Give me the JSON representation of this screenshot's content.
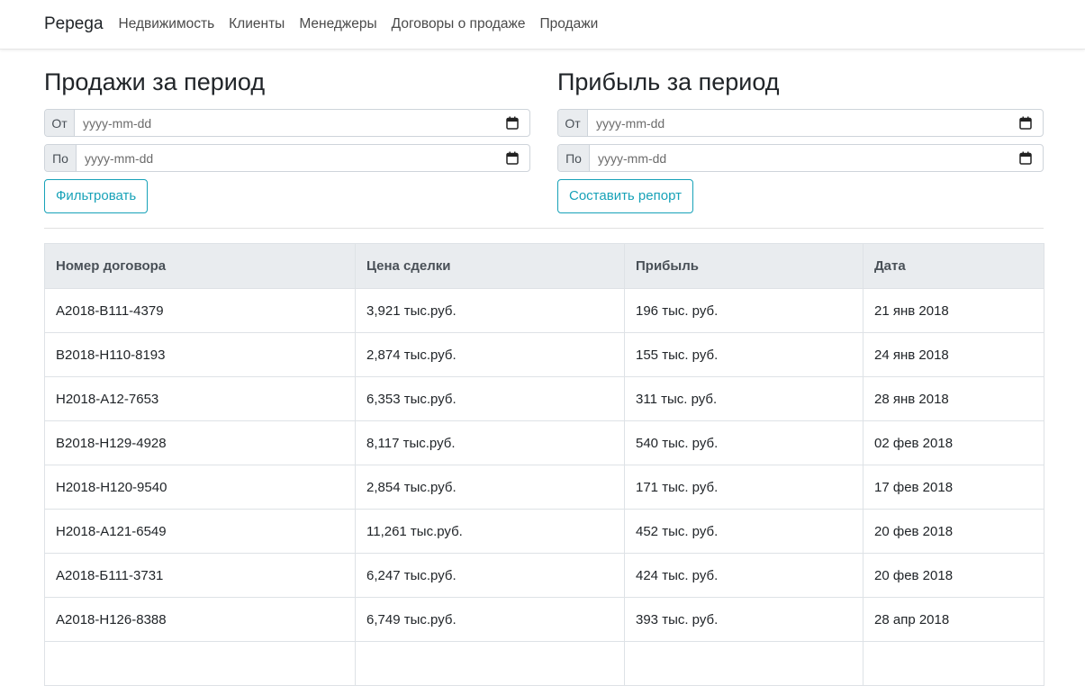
{
  "navbar": {
    "brand": "Pepega",
    "items": [
      "Недвижимость",
      "Клиенты",
      "Менеджеры",
      "Договоры о продаже",
      "Продажи"
    ]
  },
  "sales_panel": {
    "title": "Продажи за период",
    "from_label": "От",
    "to_label": "По",
    "from_placeholder": "yyyy-mm-dd",
    "to_placeholder": "yyyy-mm-dd",
    "button_label": "Фильтровать"
  },
  "profit_panel": {
    "title": "Прибыль за период",
    "from_label": "От",
    "to_label": "По",
    "from_placeholder": "yyyy-mm-dd",
    "to_placeholder": "yyyy-mm-dd",
    "button_label": "Составить репорт"
  },
  "table": {
    "headers": [
      "Номер договора",
      "Цена сделки",
      "Прибыль",
      "Дата"
    ],
    "rows": [
      [
        "А2018-В111-4379",
        "3,921 тыс.руб.",
        "196 тыс. руб.",
        "21 янв 2018"
      ],
      [
        "В2018-Н110-8193",
        "2,874 тыс.руб.",
        "155 тыс. руб.",
        "24 янв 2018"
      ],
      [
        "Н2018-А12-7653",
        "6,353 тыс.руб.",
        "311 тыс. руб.",
        "28 янв 2018"
      ],
      [
        "В2018-Н129-4928",
        "8,117 тыс.руб.",
        "540 тыс. руб.",
        "02 фев 2018"
      ],
      [
        "Н2018-Н120-9540",
        "2,854 тыс.руб.",
        "171 тыс. руб.",
        "17 фев 2018"
      ],
      [
        "Н2018-А121-6549",
        "11,261 тыс.руб.",
        "452 тыс. руб.",
        "20 фев 2018"
      ],
      [
        "А2018-Б111-3731",
        "6,247 тыс.руб.",
        "424 тыс. руб.",
        "20 фев 2018"
      ],
      [
        "А2018-Н126-8388",
        "6,749 тыс.руб.",
        "393 тыс. руб.",
        "28 апр 2018"
      ],
      [
        "",
        "",
        "",
        ""
      ]
    ]
  },
  "colors": {
    "accent": "#17a2b8",
    "header_bg": "#e9ecef",
    "border": "#dee2e6"
  }
}
